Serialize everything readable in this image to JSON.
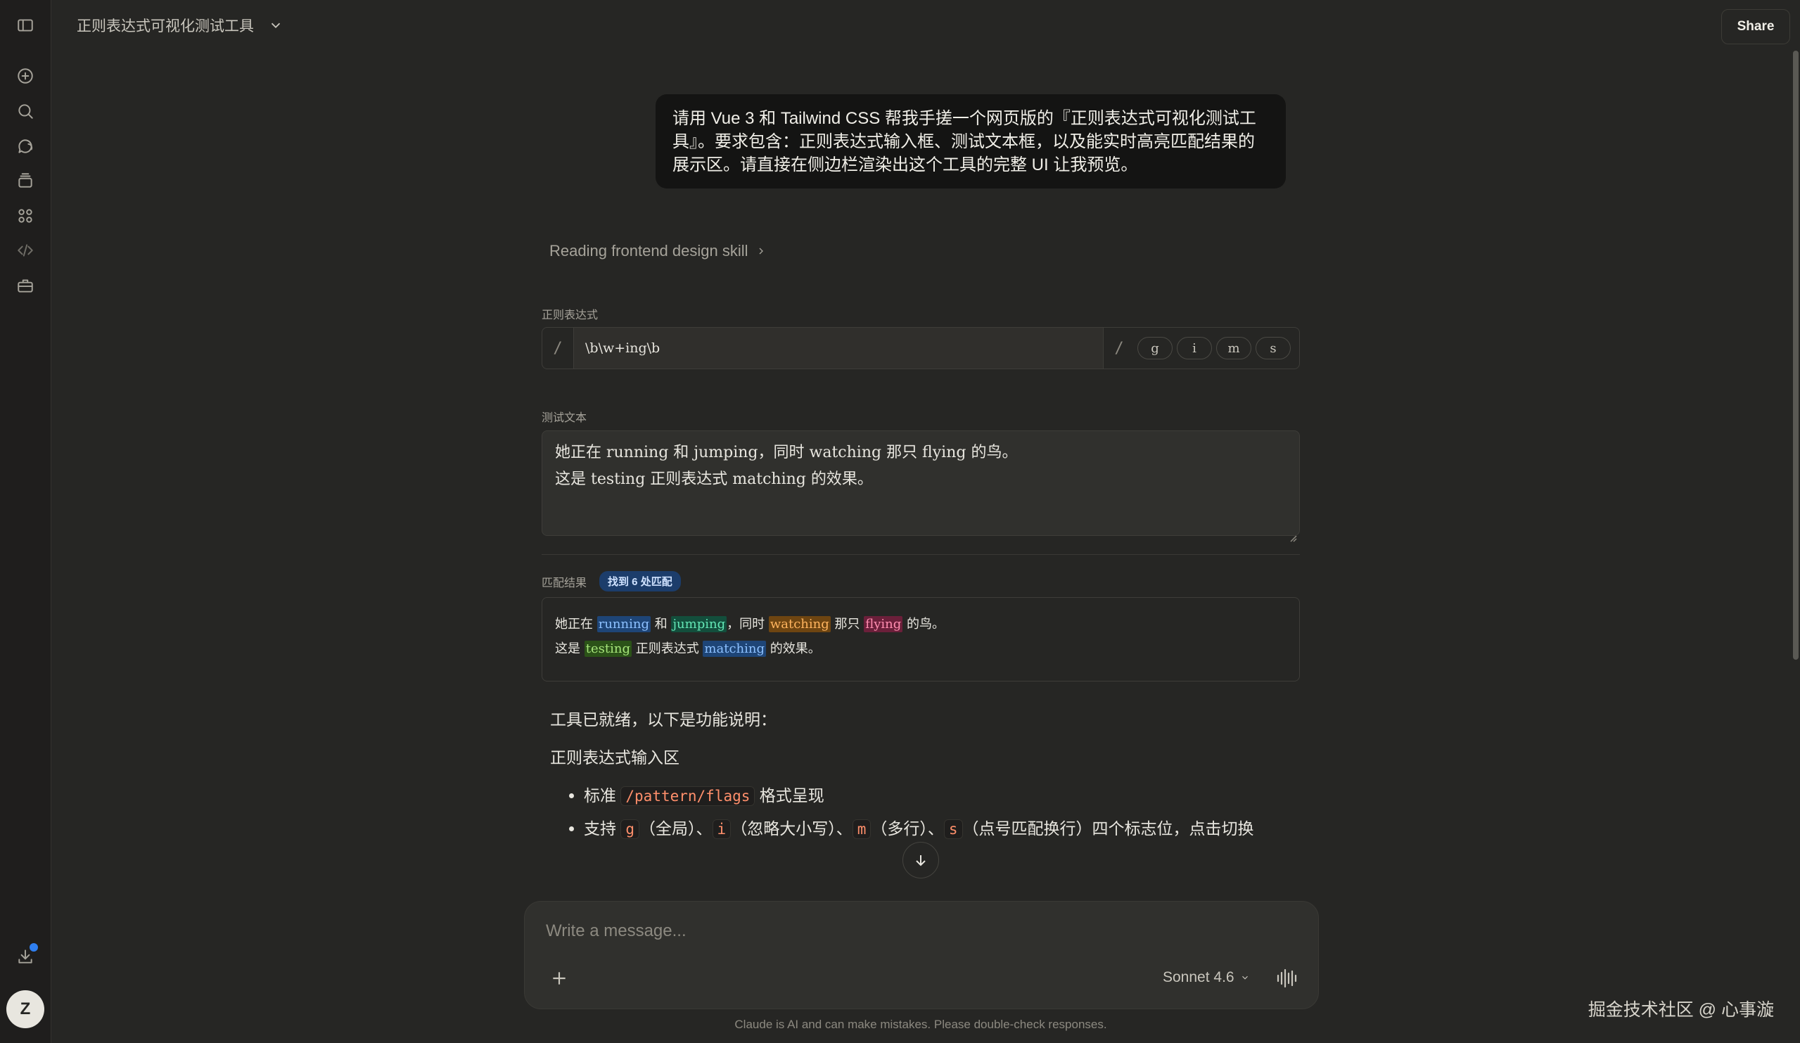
{
  "header": {
    "title": "正则表达式可视化测试工具",
    "share_label": "Share"
  },
  "conversation": {
    "user_message": "请用 Vue 3 和 Tailwind CSS 帮我手搓一个网页版的『正则表达式可视化测试工具』。要求包含：正则表达式输入框、测试文本框，以及能实时高亮匹配结果的展示区。请直接在侧边栏渲染出这个工具的完整 UI 让我预览。",
    "skill_status": "Reading frontend design skill"
  },
  "tool": {
    "regex_label": "正则表达式",
    "regex_open_slash": "/",
    "regex_value": "\\b\\w+ing\\b",
    "regex_close_slash": "/",
    "flags": [
      "g",
      "i",
      "m",
      "s"
    ],
    "test_label": "测试文本",
    "test_lines": [
      "她正在 running 和 jumping，同时 watching 那只 flying 的鸟。",
      "这是 testing 正则表达式 matching 的效果。"
    ],
    "result_label": "匹配结果",
    "match_badge": "找到 6 处匹配",
    "result_line1": {
      "t1": "她正在 ",
      "m1": "running",
      "t2": " 和 ",
      "m2": "jumping",
      "t3": "，同时 ",
      "m3": "watching",
      "t4": " 那只 ",
      "m4": "flying",
      "t5": " 的鸟。"
    },
    "result_line2": {
      "t1": "这是 ",
      "m1": "testing",
      "t2": " 正则表达式 ",
      "m2": "matching",
      "t3": " 的效果。"
    },
    "highlight_colors": [
      "#1e4577",
      "#134e3c",
      "#6e4511",
      "#6b1f3a",
      "#2b5218",
      "#1e4577"
    ]
  },
  "answer": {
    "intro": "工具已就绪，以下是功能说明：",
    "section_title": "正则表达式输入区",
    "bullet1": {
      "pre": "标准 ",
      "code": "/pattern/flags",
      "post": " 格式呈现"
    },
    "bullet2": {
      "pre": "支持 ",
      "c1": "g",
      "t1": "（全局）、",
      "c2": "i",
      "t2": "（忽略大小写）、",
      "c3": "m",
      "t3": "（多行）、",
      "c4": "s",
      "t4": "（点号匹配换行）四个标志位，点击切换"
    }
  },
  "composer": {
    "placeholder": "Write a message...",
    "model": "Sonnet 4.6"
  },
  "footer": {
    "disclaimer": "Claude is AI and can make mistakes. Please double-check responses.",
    "watermark": "掘金技术社区 @ 心事漩"
  },
  "sidebar": {
    "icons": [
      "sidebar-toggle-icon",
      "new-chat-icon",
      "search-icon",
      "chats-icon",
      "projects-icon",
      "artifacts-icon",
      "code-icon",
      "toolbox-icon",
      "download-icon"
    ],
    "avatar_initial": "Z"
  }
}
